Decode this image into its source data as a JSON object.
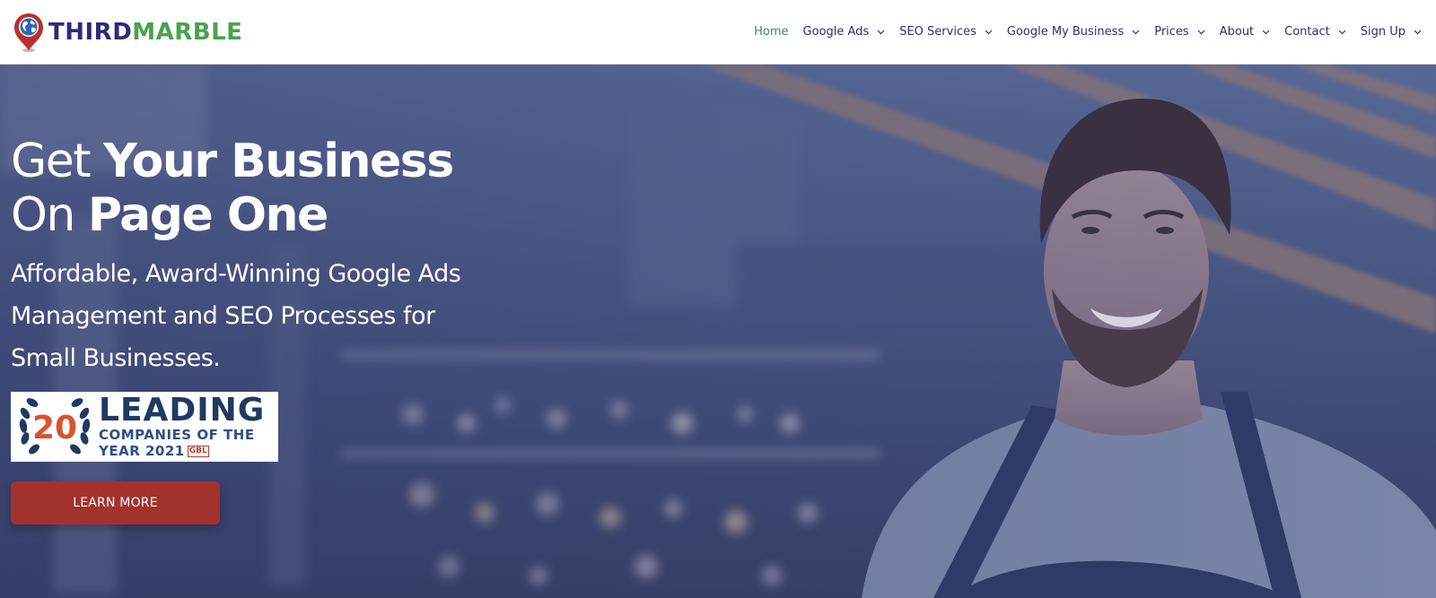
{
  "brand": {
    "name_part1": "THIRD",
    "name_part2": "MARBLE",
    "icon": "map-pin-globe-icon",
    "colors": {
      "primary": "#2b2c7a",
      "accent_green": "#4aa24a",
      "pin_red": "#b8312f"
    }
  },
  "nav": {
    "items": [
      {
        "label": "Home",
        "active": true,
        "has_dropdown": false
      },
      {
        "label": "Google Ads",
        "active": false,
        "has_dropdown": true
      },
      {
        "label": "SEO Services",
        "active": false,
        "has_dropdown": true
      },
      {
        "label": "Google My Business",
        "active": false,
        "has_dropdown": true
      },
      {
        "label": "Prices",
        "active": false,
        "has_dropdown": true
      },
      {
        "label": "About",
        "active": false,
        "has_dropdown": true
      },
      {
        "label": "Contact",
        "active": false,
        "has_dropdown": true
      },
      {
        "label": "Sign Up",
        "active": false,
        "has_dropdown": true
      }
    ],
    "active_color": "#3c8a55",
    "dropdown_icon": "chevron-down-icon"
  },
  "hero": {
    "headline_line1_light": "Get ",
    "headline_line1_bold": "Your Business",
    "headline_line2_light": "On ",
    "headline_line2_bold": "Page One",
    "subheadline": "Affordable, Award-Winning Google Ads Management and SEO Processes for Small Businesses.",
    "award_badge": {
      "number": "20",
      "title": "LEADING",
      "line2": "COMPANIES OF THE",
      "line3": "YEAR 2021",
      "mark": "GBL"
    },
    "cta_label": "LEARN MORE",
    "cta_color": "#a3322c"
  }
}
